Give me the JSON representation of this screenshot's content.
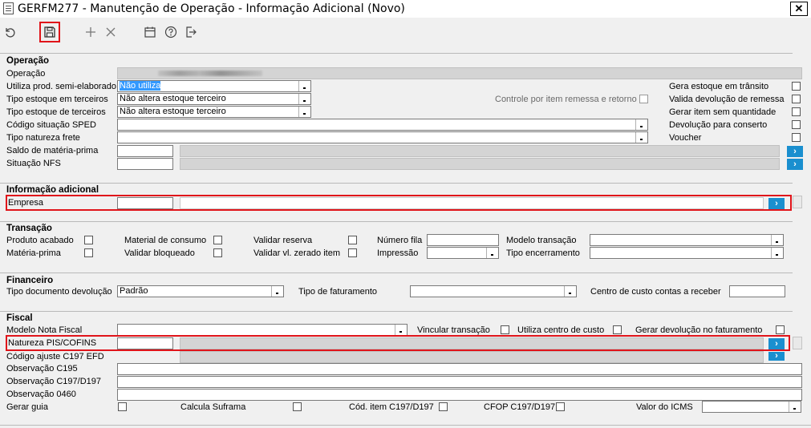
{
  "window": {
    "title": "GERFM277 - Manutenção de Operação - Informação Adicional (Novo)",
    "close_label": "✕"
  },
  "sections": {
    "operacao": {
      "title": "Operação",
      "operacao_label": "Operação",
      "operacao_value": "",
      "utiliza_label": "Utiliza prod. semi-elaborado",
      "utiliza_value": "Não utiliza",
      "tipo_estoque_em_label": "Tipo estoque em terceiros",
      "tipo_estoque_em_value": "Não altera estoque terceiro",
      "tipo_estoque_de_label": "Tipo estoque de terceiros",
      "tipo_estoque_de_value": "Não altera estoque terceiro",
      "codigo_sped_label": "Código situação SPED",
      "tipo_natureza_label": "Tipo natureza frete",
      "saldo_label": "Saldo de matéria-prima",
      "situacao_label": "Situação NFS",
      "controle_label": "Controle por item remessa e retorno",
      "gera_estoque_label": "Gera estoque em trânsito",
      "valida_devolucao_label": "Valida devolução de remessa",
      "gerar_item_label": "Gerar item sem quantidade",
      "devolucao_conserto_label": "Devolução para conserto",
      "voucher_label": "Voucher"
    },
    "info": {
      "title": "Informação adicional",
      "empresa_label": "Empresa"
    },
    "transacao": {
      "title": "Transação",
      "produto_acabado": "Produto acabado",
      "materia_prima": "Matéria-prima",
      "material_consumo": "Material de consumo",
      "validar_bloqueado": "Validar bloqueado",
      "validar_reserva": "Validar reserva",
      "validar_vl_zerado": "Validar vl. zerado item",
      "numero_fila": "Número fila",
      "impressao": "Impressão",
      "modelo_transacao": "Modelo transação",
      "tipo_encerramento": "Tipo encerramento"
    },
    "financeiro": {
      "title": "Financeiro",
      "tipo_doc_label": "Tipo documento devolução",
      "tipo_doc_value": "Padrão",
      "tipo_fat_label": "Tipo de faturamento",
      "centro_custo_label": "Centro de custo contas a receber"
    },
    "fiscal": {
      "title": "Fiscal",
      "modelo_nf": "Modelo Nota Fiscal",
      "vincular_transacao": "Vincular transação",
      "utiliza_centro": "Utiliza centro de custo",
      "gerar_devolucao": "Gerar devolução no faturamento",
      "natureza_pis": "Natureza PIS/COFINS",
      "codigo_ajuste": "Código ajuste C197 EFD",
      "obs_c195": "Observação C195",
      "obs_c197": "Observação C197/D197",
      "obs_0460": "Observação 0460",
      "gerar_guia": "Gerar guia",
      "calcula_suframa": "Calcula Suframa",
      "cod_item": "Cód. item C197/D197",
      "cfop": "CFOP C197/D197",
      "valor_icms": "Valor do ICMS"
    }
  },
  "go_button": "›",
  "colors": {
    "highlight": "#3399ff",
    "go_button": "#1a8fcf",
    "red_box": "#e0141a"
  }
}
